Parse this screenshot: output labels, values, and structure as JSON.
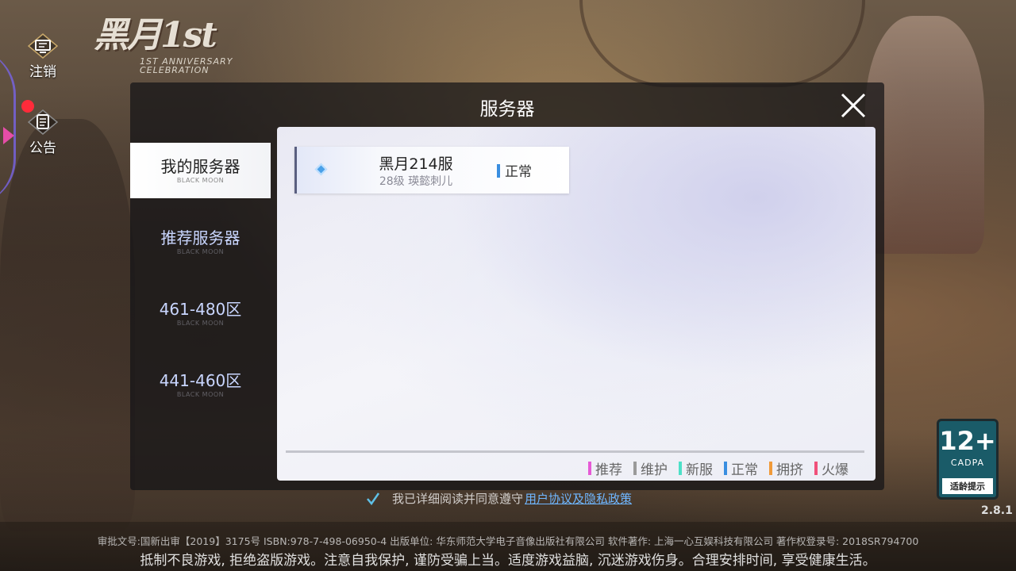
{
  "logo": {
    "text": "黑月1st",
    "subtitle_line1": "1ST ANNIVERSARY",
    "subtitle_line2": "CELEBRATION"
  },
  "side": {
    "logout_label": "注销",
    "notice_label": "公告"
  },
  "dialog": {
    "title": "服务器",
    "tabs": [
      {
        "label": "我的服务器",
        "sub": "BLACK MOON"
      },
      {
        "label": "推荐服务器",
        "sub": "BLACK MOON"
      },
      {
        "label": "461-480区",
        "sub": "BLACK MOON"
      },
      {
        "label": "441-460区",
        "sub": "BLACK MOON"
      }
    ],
    "active_tab": 0,
    "servers": [
      {
        "name": "黑月214服",
        "info": "28级  瑛懿刺儿",
        "status": "正常",
        "status_color": "#3a8ee0"
      }
    ],
    "legend": [
      {
        "label": "推荐",
        "color": "#e65ad6"
      },
      {
        "label": "维护",
        "color": "#9a9a9a"
      },
      {
        "label": "新服",
        "color": "#4de0c8"
      },
      {
        "label": "正常",
        "color": "#3a8ee0"
      },
      {
        "label": "拥挤",
        "color": "#f09a3a"
      },
      {
        "label": "火爆",
        "color": "#f0507a"
      }
    ]
  },
  "agreement": {
    "text": "我已详细阅读并同意遵守",
    "link": "用户协议及隐私政策"
  },
  "age_badge": {
    "number": "12+",
    "org": "CADPA",
    "tip": "适龄提示"
  },
  "version": "2.8.1",
  "footer": {
    "line1": "审批文号:国新出审【2019】3175号 ISBN:978-7-498-06950-4 出版单位: 华东师范大学电子音像出版社有限公司 软件著作: 上海一心互娱科技有限公司 著作权登录号: 2018SR794700",
    "line2": "抵制不良游戏, 拒绝盗版游戏。注意自我保护, 谨防受骗上当。适度游戏益脑, 沉迷游戏伤身。合理安排时间, 享受健康生活。"
  },
  "colors": {
    "accent": "#6fb6ff",
    "dialog_bg": "#141416",
    "notice_dot": "#ff2b3a"
  }
}
